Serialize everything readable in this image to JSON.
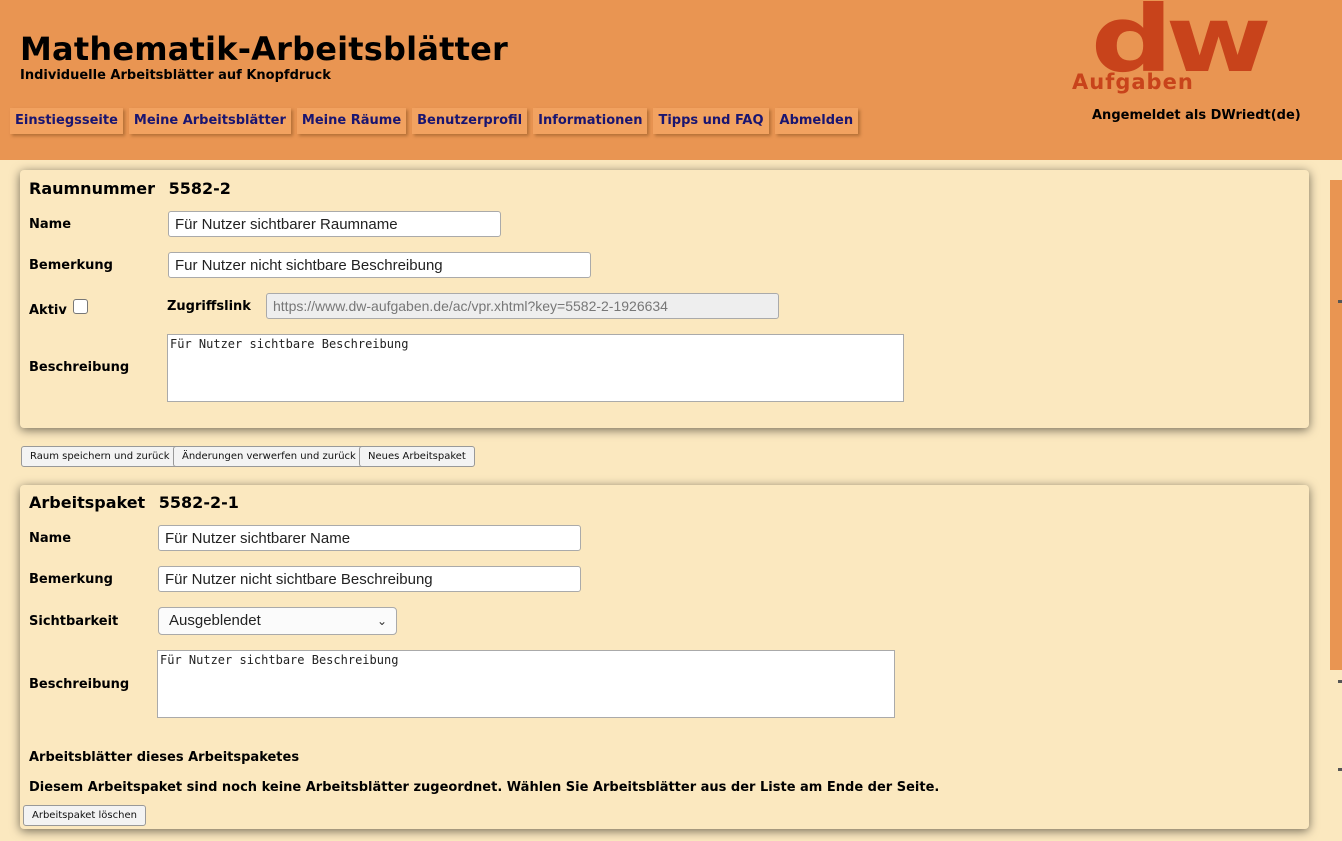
{
  "header": {
    "title": "Mathematik-Arbeitsblätter",
    "subtitle": "Individuelle Arbeitsblätter auf Knopfdruck",
    "logo_main": "dw",
    "logo_sub": "Aufgaben",
    "logged_in": "Angemeldet als DWriedt(de)"
  },
  "nav": {
    "items": [
      {
        "label": "Einstiegsseite"
      },
      {
        "label": "Meine Arbeitsblätter"
      },
      {
        "label": "Meine Räume"
      },
      {
        "label": "Benutzerprofil"
      },
      {
        "label": "Informationen"
      },
      {
        "label": "Tipps und FAQ"
      },
      {
        "label": "Abmelden"
      }
    ]
  },
  "room": {
    "title_label": "Raumnummer",
    "number": "5582-2",
    "name_label": "Name",
    "name_value": "Für Nutzer sichtbarer Raumname",
    "remark_label": "Bemerkung",
    "remark_value": "Fur Nutzer nicht sichtbare Beschreibung",
    "active_label": "Aktiv",
    "access_label": "Zugriffslink",
    "access_value": "https://www.dw-aufgaben.de/ac/vpr.xhtml?key=5582-2-1926634",
    "desc_label": "Beschreibung",
    "desc_value": "Für Nutzer sichtbare Beschreibung"
  },
  "room_actions": {
    "save": "Raum speichern und zurück",
    "discard": "Änderungen verwerfen und zurück",
    "new_package": "Neues Arbeitspaket"
  },
  "package": {
    "title_label": "Arbeitspaket",
    "number": "5582-2-1",
    "name_label": "Name",
    "name_value": "Für Nutzer sichtbarer Name",
    "remark_label": "Bemerkung",
    "remark_value": "Für Nutzer nicht sichtbare Beschreibung",
    "visibility_label": "Sichtbarkeit",
    "visibility_value": "Ausgeblendet",
    "desc_label": "Beschreibung",
    "desc_value": "Für Nutzer sichtbare Beschreibung",
    "sheets_heading": "Arbeitsblätter dieses Arbeitspaketes",
    "sheets_empty": "Diesem Arbeitspaket sind noch keine Arbeitsblätter zugeordnet. Wählen Sie Arbeitsblätter aus der Liste am Ende der Seite.",
    "delete": "Arbeitspaket löschen"
  }
}
